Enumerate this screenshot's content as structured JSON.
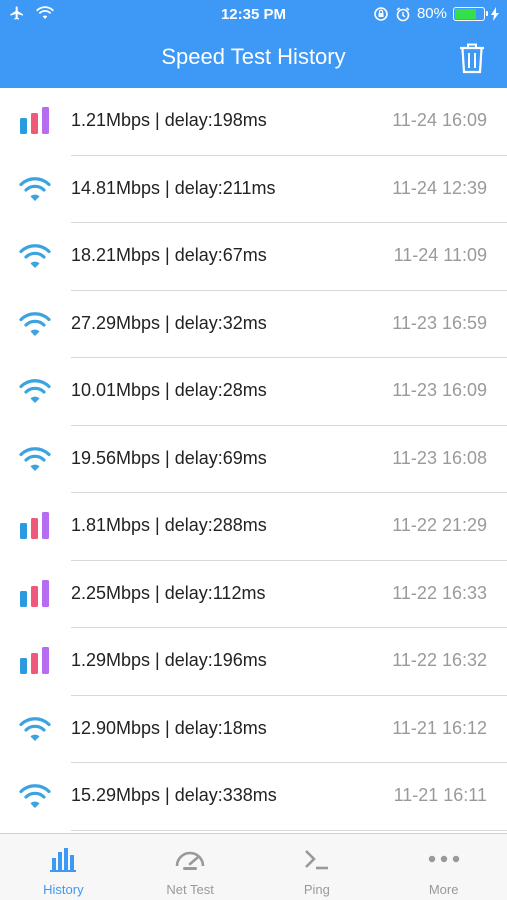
{
  "status": {
    "time": "12:35 PM",
    "battery": "80%",
    "battery_level": 0.8
  },
  "header": {
    "title": "Speed Test History"
  },
  "colors": {
    "accent": "#3d98f6",
    "wifi": "#3ba3e0"
  },
  "rows": [
    {
      "type": "cellular",
      "text": "1.21Mbps | delay:198ms",
      "time": "11-24 16:09"
    },
    {
      "type": "wifi",
      "text": "14.81Mbps | delay:211ms",
      "time": "11-24 12:39"
    },
    {
      "type": "wifi",
      "text": "18.21Mbps | delay:67ms",
      "time": "11-24 11:09"
    },
    {
      "type": "wifi",
      "text": "27.29Mbps | delay:32ms",
      "time": "11-23 16:59"
    },
    {
      "type": "wifi",
      "text": "10.01Mbps | delay:28ms",
      "time": "11-23 16:09"
    },
    {
      "type": "wifi",
      "text": "19.56Mbps | delay:69ms",
      "time": "11-23 16:08"
    },
    {
      "type": "cellular",
      "text": "1.81Mbps | delay:288ms",
      "time": "11-22 21:29"
    },
    {
      "type": "cellular",
      "text": "2.25Mbps | delay:112ms",
      "time": "11-22 16:33"
    },
    {
      "type": "cellular",
      "text": "1.29Mbps | delay:196ms",
      "time": "11-22 16:32"
    },
    {
      "type": "wifi",
      "text": "12.90Mbps | delay:18ms",
      "time": "11-21 16:12"
    },
    {
      "type": "wifi",
      "text": "15.29Mbps | delay:338ms",
      "time": "11-21 16:11"
    }
  ],
  "tabs": [
    {
      "key": "history",
      "label": "History",
      "icon": "bar-chart-icon",
      "active": true
    },
    {
      "key": "nettest",
      "label": "Net Test",
      "icon": "speedometer-icon",
      "active": false
    },
    {
      "key": "ping",
      "label": "Ping",
      "icon": "terminal-icon",
      "active": false
    },
    {
      "key": "more",
      "label": "More",
      "icon": "more-dots-icon",
      "active": false
    }
  ]
}
